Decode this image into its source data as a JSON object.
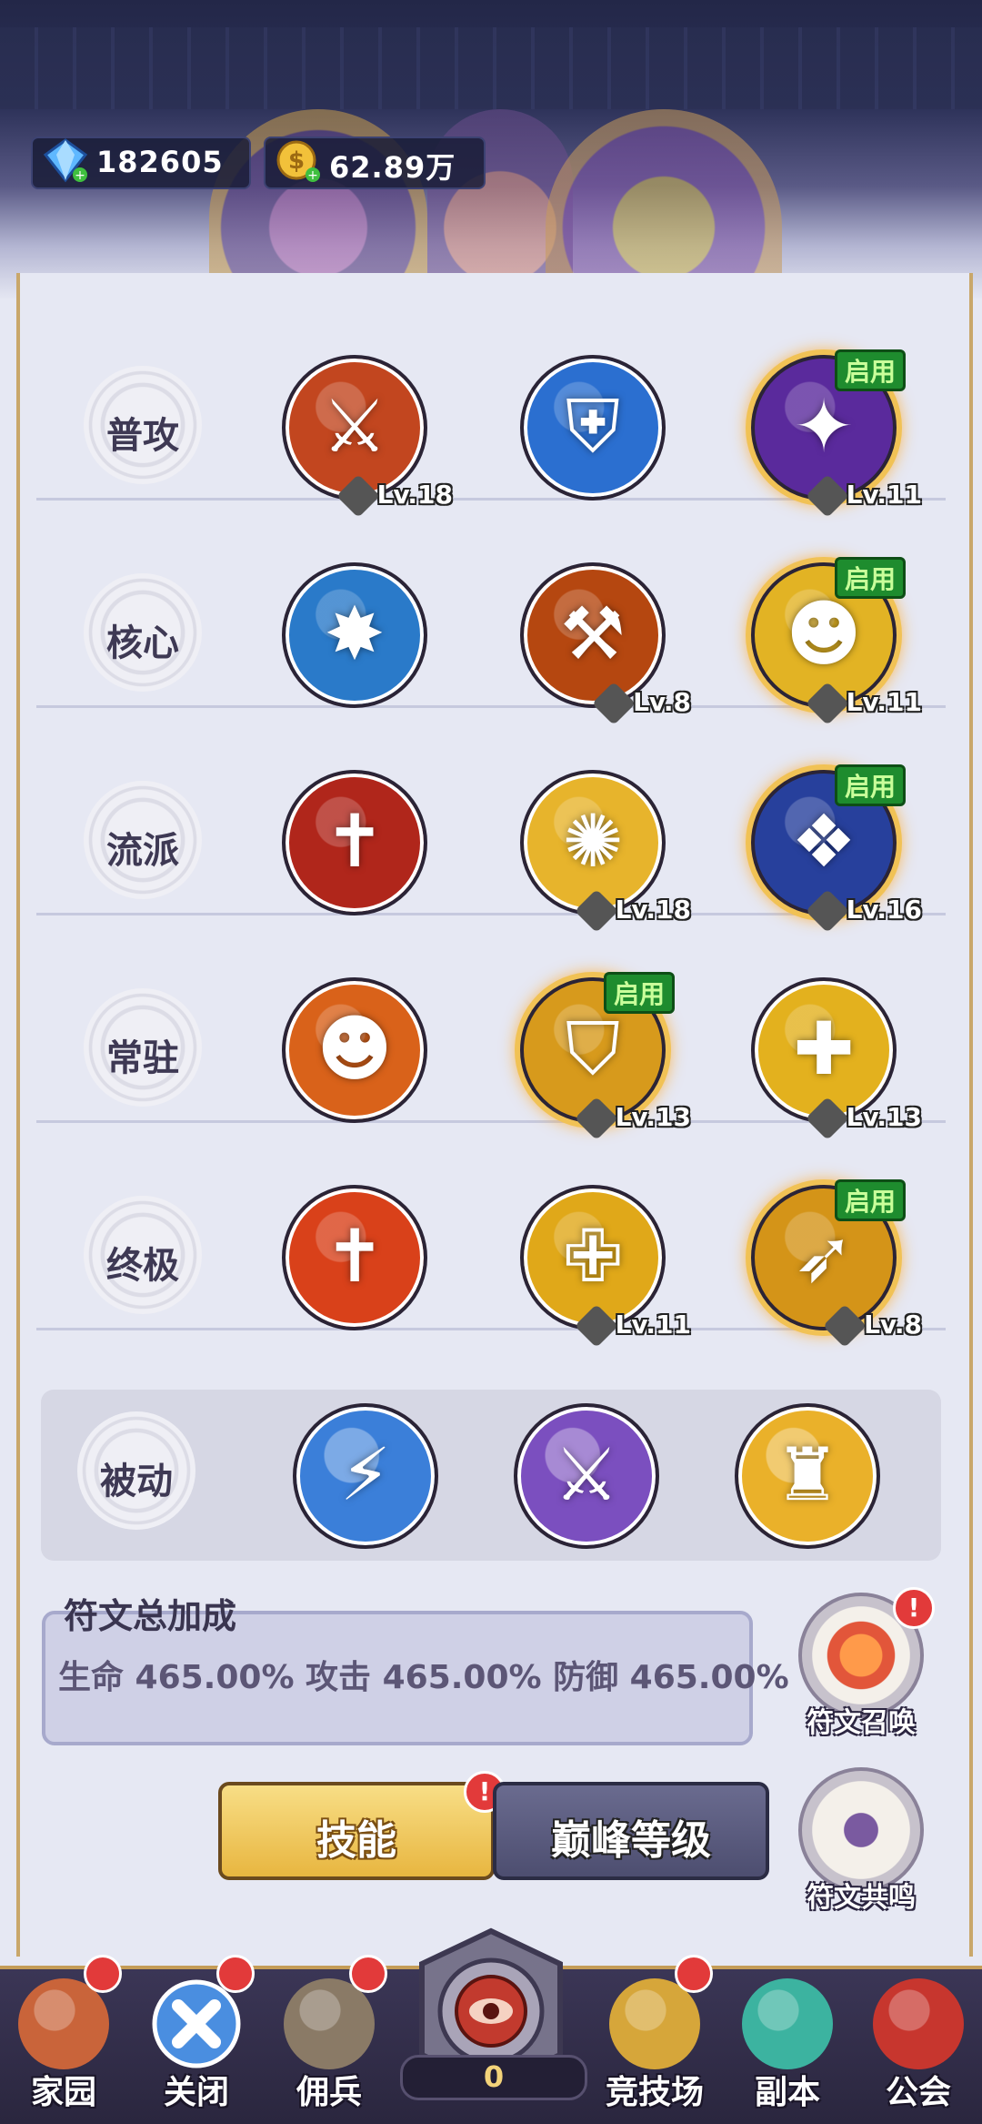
{
  "currency": {
    "diamonds": "182605",
    "gold": "62.89万"
  },
  "rows": [
    {
      "label": "普攻",
      "skills": [
        {
          "icon": "blade-slash-icon",
          "glyph": "⚔",
          "bg": "#c2461f",
          "level": "Lv.18",
          "active": false
        },
        {
          "icon": "blue-shield-icon",
          "glyph": "⛨",
          "bg": "#2b6fd0",
          "level": "",
          "active": false
        },
        {
          "icon": "purple-strike-icon",
          "glyph": "✦",
          "bg": "#5a2a9c",
          "level": "Lv.11",
          "active": true
        }
      ]
    },
    {
      "label": "核心",
      "skills": [
        {
          "icon": "shattered-shield-icon",
          "glyph": "✸",
          "bg": "#2a7ac9",
          "level": "",
          "active": false
        },
        {
          "icon": "hammer-icon",
          "glyph": "⚒",
          "bg": "#b54710",
          "level": "Lv.8",
          "active": false
        },
        {
          "icon": "chained-figure-icon",
          "glyph": "☻",
          "bg": "#e2b324",
          "level": "Lv.11",
          "active": true
        }
      ]
    },
    {
      "label": "流派",
      "skills": [
        {
          "icon": "great-sword-icon",
          "glyph": "✝",
          "bg": "#b0261b",
          "level": "",
          "active": false
        },
        {
          "icon": "golden-rays-icon",
          "glyph": "✺",
          "bg": "#e7b42c",
          "level": "Lv.18",
          "active": false
        },
        {
          "icon": "blue-gauntlet-icon",
          "glyph": "❖",
          "bg": "#27409c",
          "level": "Lv.16",
          "active": true
        }
      ]
    },
    {
      "label": "常驻",
      "skills": [
        {
          "icon": "rage-figure-icon",
          "glyph": "☻",
          "bg": "#d9621a",
          "level": "",
          "active": false
        },
        {
          "icon": "silver-shield-icon",
          "glyph": "⛉",
          "bg": "#d79a1c",
          "level": "Lv.13",
          "active": true
        },
        {
          "icon": "stunned-figure-icon",
          "glyph": "✚",
          "bg": "#e3b11e",
          "level": "Lv.13",
          "active": false
        }
      ]
    },
    {
      "label": "终极",
      "skills": [
        {
          "icon": "fire-sword-icon",
          "glyph": "✝",
          "bg": "#d9411a",
          "level": "",
          "active": false
        },
        {
          "icon": "holy-shield-icon",
          "glyph": "✙",
          "bg": "#e0a819",
          "level": "Lv.11",
          "active": false
        },
        {
          "icon": "golden-bow-icon",
          "glyph": "➶",
          "bg": "#d49418",
          "level": "Lv.8",
          "active": true
        }
      ]
    }
  ],
  "passive": {
    "label": "被动",
    "skills": [
      {
        "icon": "blue-sword-emblem-icon",
        "glyph": "⚡",
        "bg": "#3b7fd9"
      },
      {
        "icon": "winged-sword-icon",
        "glyph": "⚔",
        "bg": "#7b4fbf"
      },
      {
        "icon": "tower-icon",
        "glyph": "♜",
        "bg": "#eab12a"
      }
    ]
  },
  "active_badge": "启用",
  "rune": {
    "title": "符文总加成",
    "stats": "生命 465.00%  攻击 465.00%  防御 465.00%"
  },
  "side": {
    "summon": "符文召唤",
    "resonance": "符文共鸣"
  },
  "buttons": {
    "skill": "技能",
    "peak": "巅峰等级"
  },
  "nav": {
    "items": [
      "家园",
      "关闭",
      "佣兵",
      "竞技场",
      "副本",
      "公会"
    ],
    "counter": "0"
  },
  "colors": {
    "accent_gold": "#e8b640",
    "active_green": "#1e8c2e",
    "alert_red": "#e23a3a"
  }
}
